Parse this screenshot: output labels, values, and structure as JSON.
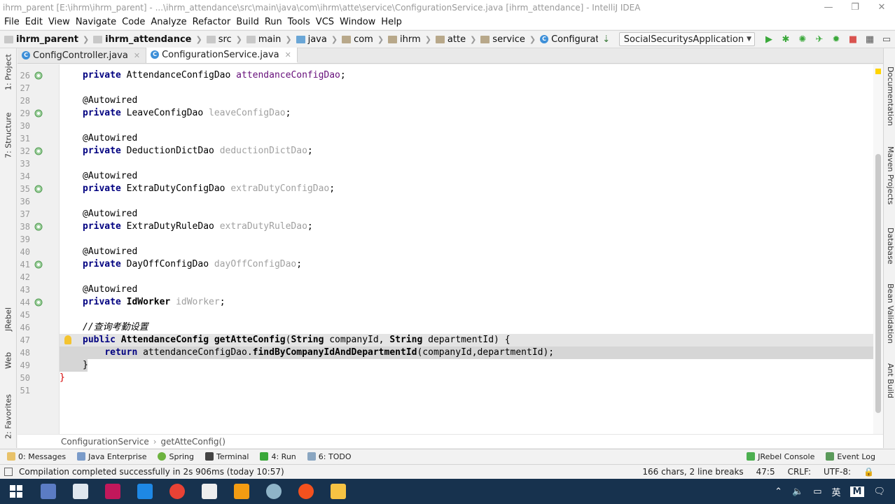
{
  "window": {
    "title": "ihrm_parent [E:\\ihrm\\ihrm_parent] - ...\\ihrm_attendance\\src\\main\\java\\com\\ihrm\\atte\\service\\ConfigurationService.java [ihrm_attendance] - IntelliJ IDEA",
    "controls": {
      "minimize": "—",
      "restore": "❐",
      "close": "✕"
    }
  },
  "menu": [
    "File",
    "Edit",
    "View",
    "Navigate",
    "Code",
    "Analyze",
    "Refactor",
    "Build",
    "Run",
    "Tools",
    "VCS",
    "Window",
    "Help"
  ],
  "breadcrumb": [
    "ihrm_parent",
    "ihrm_attendance",
    "src",
    "main",
    "java",
    "com",
    "ihrm",
    "atte",
    "service",
    "ConfigurationService"
  ],
  "run_config": "SocialSecuritysApplication",
  "tabs": [
    {
      "label": "ConfigController.java",
      "active": false
    },
    {
      "label": "ConfigurationService.java",
      "active": true
    }
  ],
  "left_panels": [
    "1: Project",
    "7: Structure",
    "JRebel",
    "Web",
    "2: Favorites"
  ],
  "right_panels": [
    "Documentation",
    "Maven Projects",
    "Database",
    "Bean Validation",
    "Ant Build"
  ],
  "code_lines": [
    {
      "n": "26",
      "code": "private AttendanceConfigDao attendanceConfigDao;"
    },
    {
      "n": "27",
      "code": ""
    },
    {
      "n": "28",
      "code": "@Autowired"
    },
    {
      "n": "29",
      "code": "private LeaveConfigDao leaveConfigDao;"
    },
    {
      "n": "30",
      "code": ""
    },
    {
      "n": "31",
      "code": "@Autowired"
    },
    {
      "n": "32",
      "code": "private DeductionDictDao deductionDictDao;"
    },
    {
      "n": "33",
      "code": ""
    },
    {
      "n": "34",
      "code": "@Autowired"
    },
    {
      "n": "35",
      "code": "private ExtraDutyConfigDao extraDutyConfigDao;"
    },
    {
      "n": "36",
      "code": ""
    },
    {
      "n": "37",
      "code": "@Autowired"
    },
    {
      "n": "38",
      "code": "private ExtraDutyRuleDao extraDutyRuleDao;"
    },
    {
      "n": "39",
      "code": ""
    },
    {
      "n": "40",
      "code": "@Autowired"
    },
    {
      "n": "41",
      "code": "private DayOffConfigDao dayOffConfigDao;"
    },
    {
      "n": "42",
      "code": ""
    },
    {
      "n": "43",
      "code": "@Autowired"
    },
    {
      "n": "44",
      "code": "private IdWorker idWorker;"
    },
    {
      "n": "45",
      "code": ""
    },
    {
      "n": "46",
      "code": "//查询考勤设置"
    },
    {
      "n": "47",
      "code": "public AttendanceConfig getAtteConfig(String companyId, String departmentId) {"
    },
    {
      "n": "48",
      "code": "    return attendanceConfigDao.findByCompanyIdAndDepartmentId(companyId,departmentId);"
    },
    {
      "n": "49",
      "code": "}"
    },
    {
      "n": "50",
      "code": "}"
    },
    {
      "n": "51",
      "code": ""
    }
  ],
  "editor_breadcrumb": [
    "ConfigurationService",
    "getAtteConfig()"
  ],
  "tool_windows": [
    {
      "label": "0: Messages"
    },
    {
      "label": "Java Enterprise"
    },
    {
      "label": "Spring"
    },
    {
      "label": "Terminal"
    },
    {
      "label": "4: Run"
    },
    {
      "label": "6: TODO"
    }
  ],
  "tool_windows_right": [
    "JRebel Console",
    "Event Log"
  ],
  "status": {
    "message": "Compilation completed successfully in 2s 906ms (today 10:57)",
    "selection": "166 chars, 2 line breaks",
    "position": "47:5",
    "line_sep": "CRLF:",
    "encoding": "UTF-8:"
  },
  "tray": {
    "ime": "英",
    "ime2": "M"
  },
  "colors": {
    "keyword": "#000080",
    "annotation": "#808000",
    "unused": "#a0a0a0",
    "comment": "#808080",
    "taskbar": "#17324e"
  }
}
